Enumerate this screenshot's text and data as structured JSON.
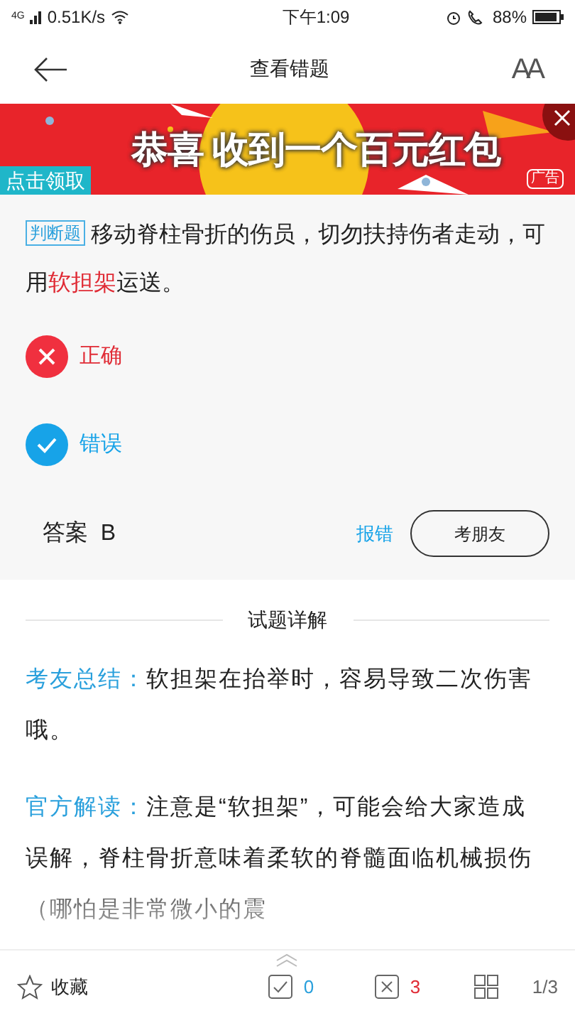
{
  "status_bar": {
    "network": "4G",
    "speed": "0.51K/s",
    "time": "下午1:09",
    "battery": "88%"
  },
  "header": {
    "title": "查看错题",
    "font_button": "AA"
  },
  "banner": {
    "headline": "恭喜 收到一个百元红包",
    "cta": "点击领取",
    "ad_badge": "广告"
  },
  "question": {
    "type_tag": "判断题",
    "text": "移动脊柱骨折的伤员，切勿扶持伤者走动，可用**软担架**运送。",
    "options": [
      {
        "label": "正确",
        "correct": false
      },
      {
        "label": "错误",
        "correct": true
      }
    ],
    "answer": "答案  B",
    "report": "报错",
    "ask_button": "考朋友"
  },
  "explanation": {
    "title": "试题详解",
    "sections": [
      {
        "label": "考友总结：",
        "text": "软担架在抬举时，容易导致二次伤害哦。"
      },
      {
        "label": "官方解读：",
        "text": "注意是“软担架”，可能会给大家造成误解，脊柱骨折意味着柔软的脊髓面临机械损伤（哪怕是非常微小的震"
      }
    ]
  },
  "bottom_bar": {
    "favorite": "收藏",
    "correct_count": "0",
    "wrong_count": "3",
    "page": "1/3"
  }
}
